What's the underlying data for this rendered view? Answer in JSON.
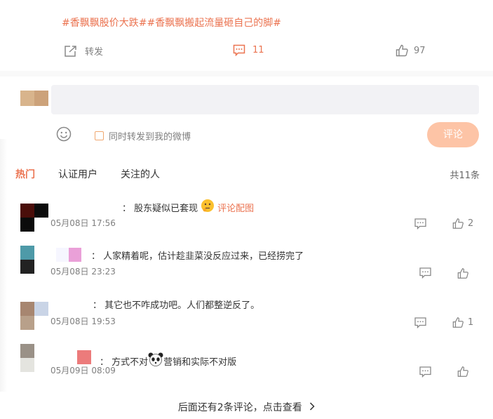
{
  "post": {
    "hashtags": "#香飘飘股价大跌##香飘飘搬起流量砸自己的脚#",
    "forward_label": "转发",
    "comment_count": "11",
    "like_count": "97"
  },
  "composer": {
    "forward_checkbox_label": "同时转发到我的微博",
    "submit_label": "评论"
  },
  "filter_tabs": [
    "热门",
    "认证用户",
    "关注的人"
  ],
  "total_label": "共11条",
  "comments": [
    {
      "text": "： 股东疑似已套现",
      "extra_label": "评论配图",
      "time": "05月08日 17:56",
      "likes": "2"
    },
    {
      "text": "： 人家精着呢，估计趁韭菜没反应过来，已经捞完了",
      "time": "05月08日 23:23",
      "likes": ""
    },
    {
      "text": "： 其它也不咋成功吧。人们都整逆反了。",
      "time": "05月08日 19:53",
      "likes": "1"
    },
    {
      "text_before": "： 方式不对",
      "text_after": "营销和实际不对版",
      "time": "05月09日 08:09",
      "likes": ""
    }
  ],
  "more_label": "后面还有2条评论，点击查看",
  "colors": {
    "accent": "#eb7350",
    "submit_bg": "#fdc4a6",
    "input_bg": "#f2f2f5"
  }
}
